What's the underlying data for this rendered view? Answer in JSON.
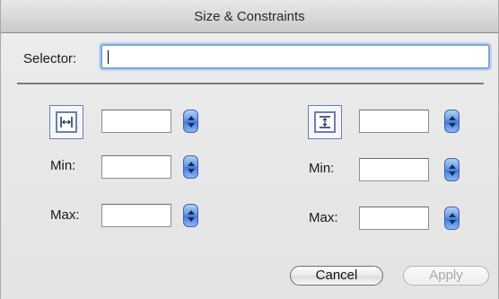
{
  "window": {
    "title": "Size & Constraints"
  },
  "selector": {
    "label": "Selector:",
    "value": ""
  },
  "width_group": {
    "icon": "horizontal-resize-icon",
    "value": "",
    "min_label": "Min:",
    "min_value": "",
    "max_label": "Max:",
    "max_value": ""
  },
  "height_group": {
    "icon": "vertical-resize-icon",
    "value": "",
    "min_label": "Min:",
    "min_value": "",
    "max_label": "Max:",
    "max_value": ""
  },
  "buttons": {
    "cancel": "Cancel",
    "apply": "Apply"
  },
  "colors": {
    "accent": "#3e78da",
    "focus_ring": "#7fa6dc",
    "icon_border": "#6c7fb0"
  }
}
